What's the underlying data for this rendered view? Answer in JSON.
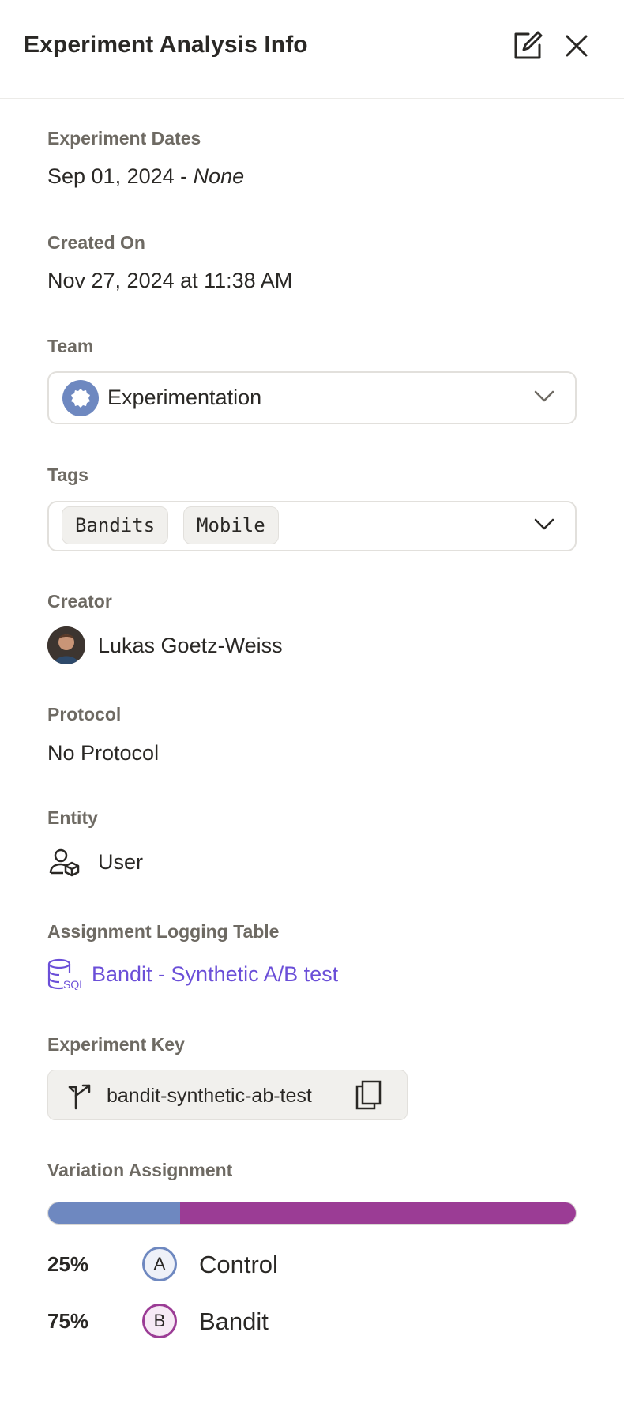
{
  "header": {
    "title": "Experiment Analysis Info"
  },
  "dates": {
    "label": "Experiment Dates",
    "start": "Sep 01, 2024 - ",
    "end": "None"
  },
  "created": {
    "label": "Created On",
    "value": "Nov 27, 2024 at 11:38 AM"
  },
  "team": {
    "label": "Team",
    "value": "Experimentation"
  },
  "tags": {
    "label": "Tags",
    "items": [
      "Bandits",
      "Mobile"
    ]
  },
  "creator": {
    "label": "Creator",
    "name": "Lukas Goetz-Weiss"
  },
  "protocol": {
    "label": "Protocol",
    "value": "No Protocol"
  },
  "entity": {
    "label": "Entity",
    "value": "User"
  },
  "logging": {
    "label": "Assignment Logging Table",
    "value": "Bandit - Synthetic A/B test"
  },
  "key": {
    "label": "Experiment Key",
    "value": "bandit-synthetic-ab-test"
  },
  "variation": {
    "label": "Variation Assignment",
    "items": [
      {
        "letter": "A",
        "name": "Control",
        "percent_text": "25%",
        "fraction": 0.25,
        "color": "#6e88c0",
        "bg": "#eef1f8"
      },
      {
        "letter": "B",
        "name": "Bandit",
        "percent_text": "75%",
        "fraction": 0.75,
        "color": "#9b3c95",
        "bg": "#f6eaf5"
      }
    ]
  },
  "colors": {
    "link": "#6b4fd8",
    "label": "#6e6a63"
  }
}
